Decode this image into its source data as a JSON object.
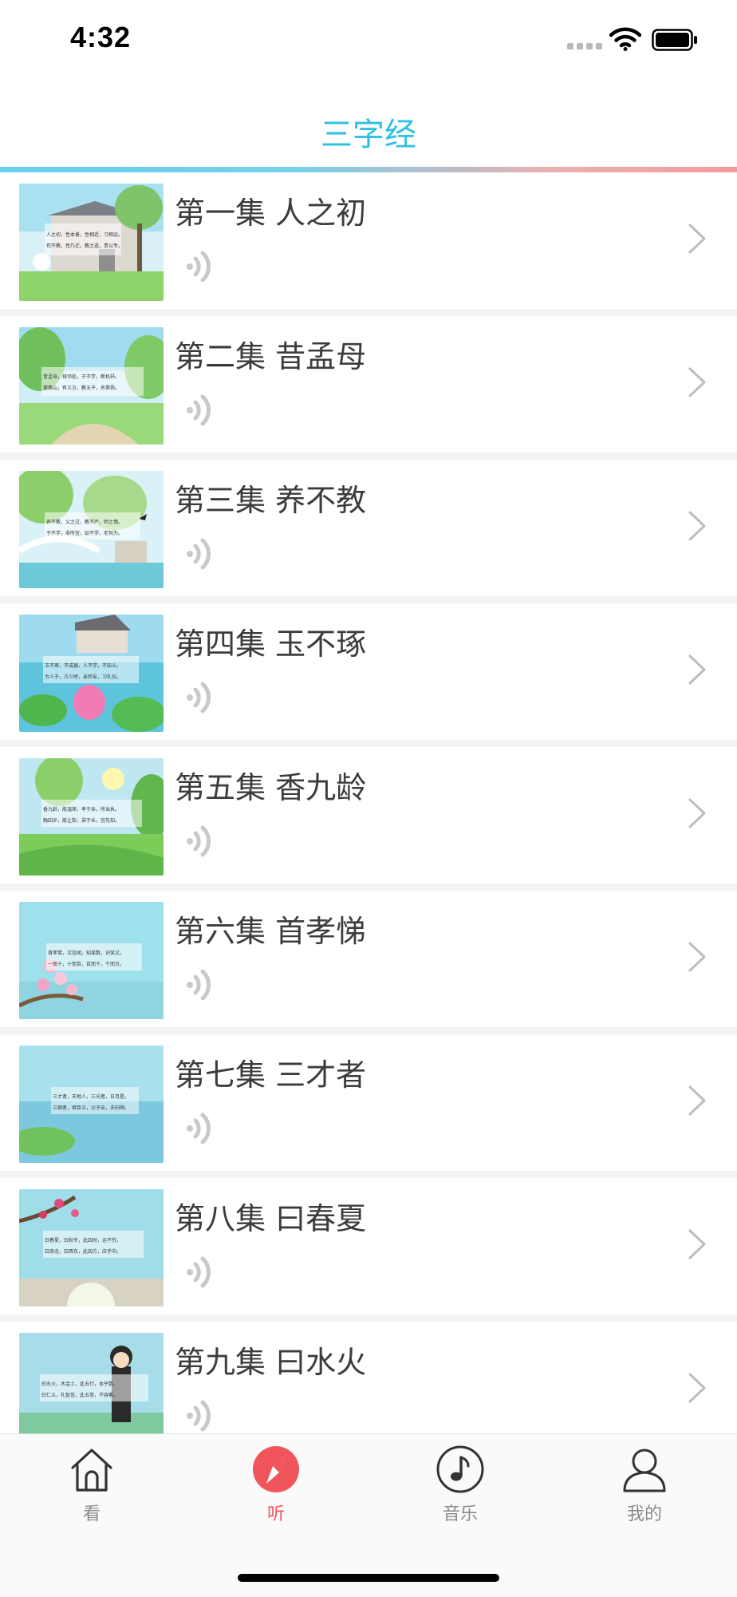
{
  "status_bar": {
    "time": "4:32"
  },
  "header": {
    "title": "三字经"
  },
  "episodes": [
    {
      "title": "第一集 人之初",
      "thumb_text_1": "人之初，性本善，性相近，习相远。",
      "thumb_text_2": "苟不教，性乃迁，教之道，贵以专。"
    },
    {
      "title": "第二集 昔孟母",
      "thumb_text_1": "昔孟母，择邻处，子不学，断机杼。",
      "thumb_text_2": "窦燕山，有义方，教五子，名俱扬。"
    },
    {
      "title": "第三集 养不教",
      "thumb_text_1": "养不教，父之过，教不严，师之惰。",
      "thumb_text_2": "子不学，非所宜，幼不学，老何为。"
    },
    {
      "title": "第四集 玉不琢",
      "thumb_text_1": "玉不琢，不成器，人不学，不知义。",
      "thumb_text_2": "为人子，方少时，亲师友，习礼仪。"
    },
    {
      "title": "第五集 香九龄",
      "thumb_text_1": "香九龄，能温席，孝于亲，所当执。",
      "thumb_text_2": "融四岁，能让梨，弟于长，宜先知。"
    },
    {
      "title": "第六集 首孝悌",
      "thumb_text_1": "首孝悌，次见闻，知某数，识某文。",
      "thumb_text_2": "一而十，十而百，百而千，千而万。"
    },
    {
      "title": "第七集 三才者",
      "thumb_text_1": "三才者，天地人，三光者，日月星。",
      "thumb_text_2": "三纲者，君臣义，父子亲，夫妇顺。"
    },
    {
      "title": "第八集 曰春夏",
      "thumb_text_1": "曰春夏，曰秋冬，此四时，运不穷。",
      "thumb_text_2": "曰南北，曰西东，此四方，应乎中。"
    },
    {
      "title": "第九集 曰水火",
      "thumb_text_1": "曰水火，木金土，此五行，本乎数。",
      "thumb_text_2": "曰仁义，礼智信，此五常，不容紊。"
    }
  ],
  "tabs": [
    {
      "label": "看",
      "icon": "home-icon"
    },
    {
      "label": "听",
      "icon": "compass-icon",
      "active": true
    },
    {
      "label": "音乐",
      "icon": "music-note-icon"
    },
    {
      "label": "我的",
      "icon": "user-icon"
    }
  ],
  "colors": {
    "title_accent": "#2ec1e3",
    "active_tab": "#f0555c",
    "inactive_tab": "#8a8a8a"
  }
}
